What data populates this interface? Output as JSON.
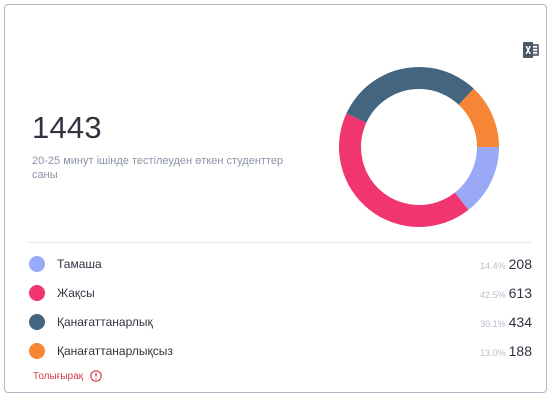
{
  "card": {
    "excel_icon": "excel-export-icon",
    "total": "1443",
    "subtitle": "20-25 минут ішінде тестілеуден өткен студенттер саны"
  },
  "donut": {
    "segments": [
      {
        "label": "Тамаша",
        "percent": 14.4,
        "color": "#9aa9f5"
      },
      {
        "label": "Жақсы",
        "percent": 42.5,
        "color": "#f0356f"
      },
      {
        "label": "Қанағаттанарлық",
        "percent": 30.1,
        "color": "#436580"
      },
      {
        "label": "Қанағаттанарлықсыз",
        "percent": 13.0,
        "color": "#f68636"
      }
    ]
  },
  "legend": [
    {
      "label": "Тамаша",
      "percent": "14.4%",
      "count": "208",
      "color": "#9aa9f5"
    },
    {
      "label": "Жақсы",
      "percent": "42.5%",
      "count": "613",
      "color": "#f0356f"
    },
    {
      "label": "Қанағаттанарлық",
      "percent": "30.1%",
      "count": "434",
      "color": "#436580"
    },
    {
      "label": "Қанағаттанарлықсыз",
      "percent": "13.0%",
      "count": "188",
      "color": "#f68636"
    }
  ],
  "details": {
    "label": "Толығырақ",
    "icon": "info-icon"
  }
}
